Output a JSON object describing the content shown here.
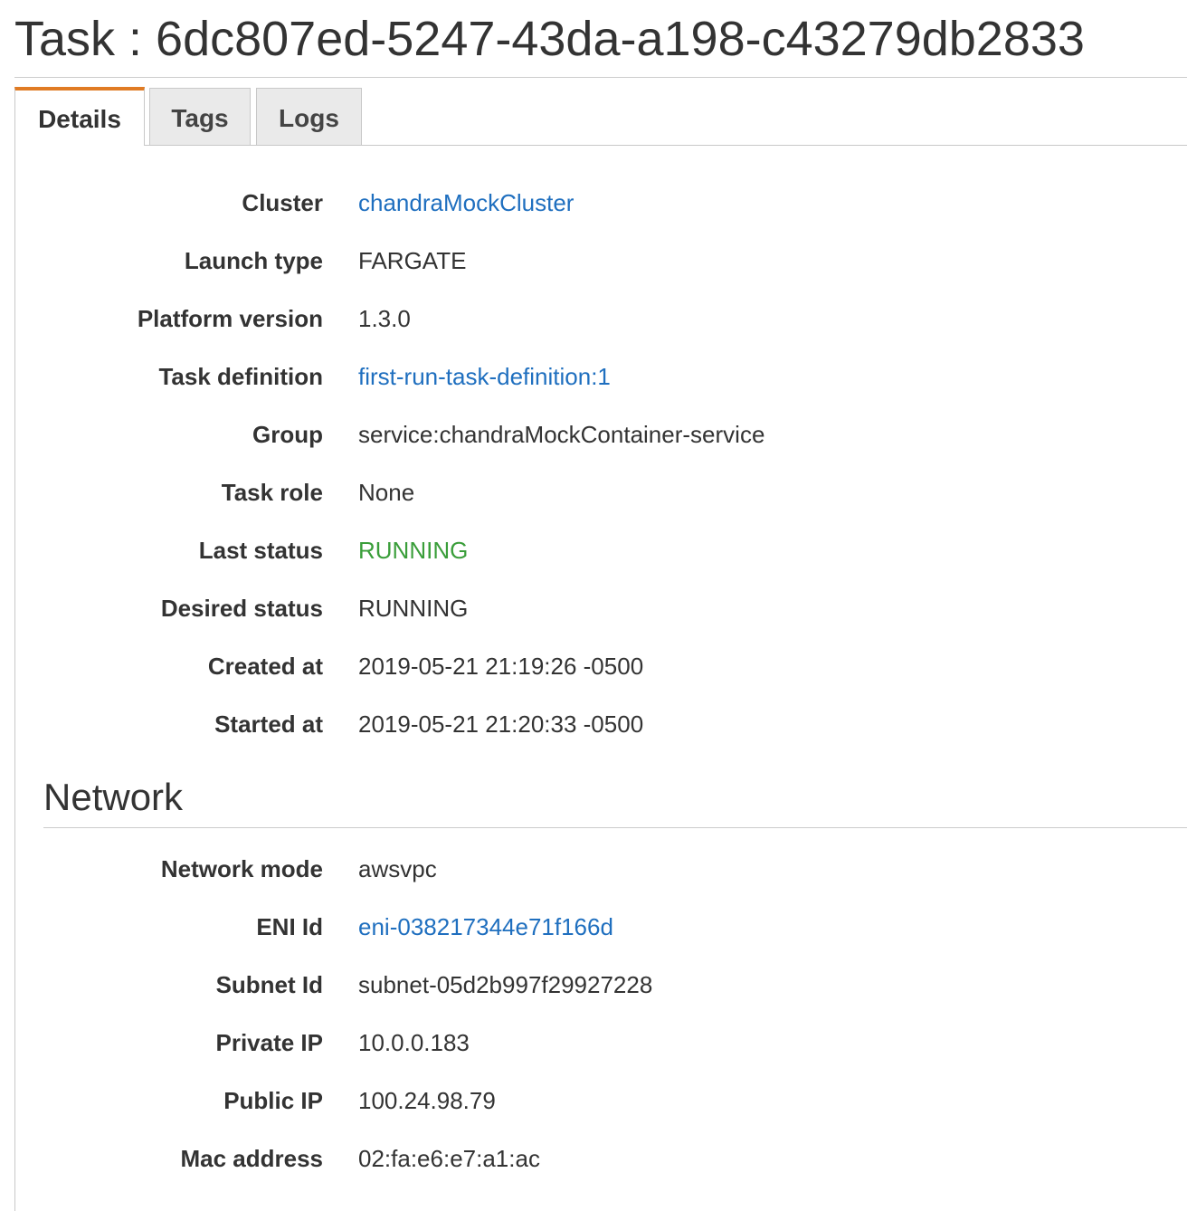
{
  "title": "Task : 6dc807ed-5247-43da-a198-c43279db2833",
  "tabs": [
    {
      "label": "Details",
      "active": true
    },
    {
      "label": "Tags",
      "active": false
    },
    {
      "label": "Logs",
      "active": false
    }
  ],
  "details": {
    "cluster": {
      "label": "Cluster",
      "value": "chandraMockCluster"
    },
    "launch_type": {
      "label": "Launch type",
      "value": "FARGATE"
    },
    "platform_version": {
      "label": "Platform version",
      "value": "1.3.0"
    },
    "task_definition": {
      "label": "Task definition",
      "value": "first-run-task-definition:1"
    },
    "group": {
      "label": "Group",
      "value": "service:chandraMockContainer-service"
    },
    "task_role": {
      "label": "Task role",
      "value": "None"
    },
    "last_status": {
      "label": "Last status",
      "value": "RUNNING"
    },
    "desired_status": {
      "label": "Desired status",
      "value": "RUNNING"
    },
    "created_at": {
      "label": "Created at",
      "value": "2019-05-21 21:19:26 -0500"
    },
    "started_at": {
      "label": "Started at",
      "value": "2019-05-21 21:20:33 -0500"
    }
  },
  "network": {
    "heading": "Network",
    "network_mode": {
      "label": "Network mode",
      "value": "awsvpc"
    },
    "eni_id": {
      "label": "ENI Id",
      "value": "eni-038217344e71f166d"
    },
    "subnet_id": {
      "label": "Subnet Id",
      "value": "subnet-05d2b997f29927228"
    },
    "private_ip": {
      "label": "Private IP",
      "value": "10.0.0.183"
    },
    "public_ip": {
      "label": "Public IP",
      "value": "100.24.98.79"
    },
    "mac_address": {
      "label": "Mac address",
      "value": "02:fa:e6:e7:a1:ac"
    }
  },
  "colors": {
    "link": "#1f6fbf",
    "status_running": "#3a9e3a",
    "active_tab_accent": "#e07b24",
    "tab_inactive_bg": "#eaeaea"
  }
}
